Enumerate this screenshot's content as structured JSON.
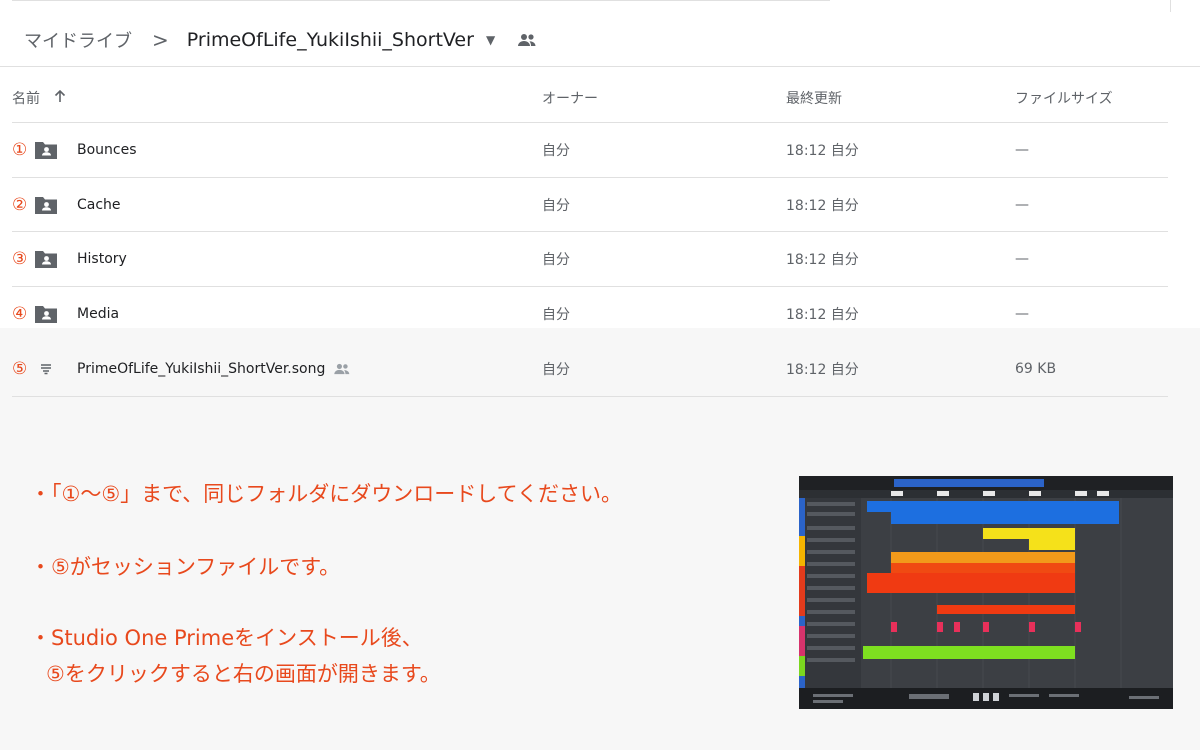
{
  "breadcrumb": {
    "root": "マイドライブ",
    "separator": ">",
    "current": "PrimeOfLife_YukiIshii_ShortVer"
  },
  "columns": {
    "name": "名前",
    "owner": "オーナー",
    "modified": "最終更新",
    "size": "ファイルサイズ"
  },
  "rows": [
    {
      "num": "①",
      "type": "shared-folder-icon",
      "name": "Bounces",
      "owner": "自分",
      "modified": "18:12 自分",
      "size": "—"
    },
    {
      "num": "②",
      "type": "shared-folder-icon",
      "name": "Cache",
      "owner": "自分",
      "modified": "18:12 自分",
      "size": "—"
    },
    {
      "num": "③",
      "type": "shared-folder-icon",
      "name": "History",
      "owner": "自分",
      "modified": "18:12 自分",
      "size": "—"
    },
    {
      "num": "④",
      "type": "shared-folder-icon",
      "name": "Media",
      "owner": "自分",
      "modified": "18:12 自分",
      "size": "—"
    },
    {
      "num": "⑤",
      "type": "file-icon",
      "name": "PrimeOfLife_YukiIshii_ShortVer.song",
      "owner": "自分",
      "modified": "18:12 自分",
      "size": "69 KB"
    }
  ],
  "notes": {
    "line1": "・「①〜⑤」まで、同じフォルダにダウンロードしてください。",
    "line2": "・⑤がセッションファイルです。",
    "line3a": "・Studio One Primeをインストール後、",
    "line3b": "⑤をクリックすると右の画面が開きます。"
  },
  "colors": {
    "accent": "#e8491d",
    "text": "#202124",
    "muted": "#5f6368",
    "divider": "#e0e0e0"
  }
}
